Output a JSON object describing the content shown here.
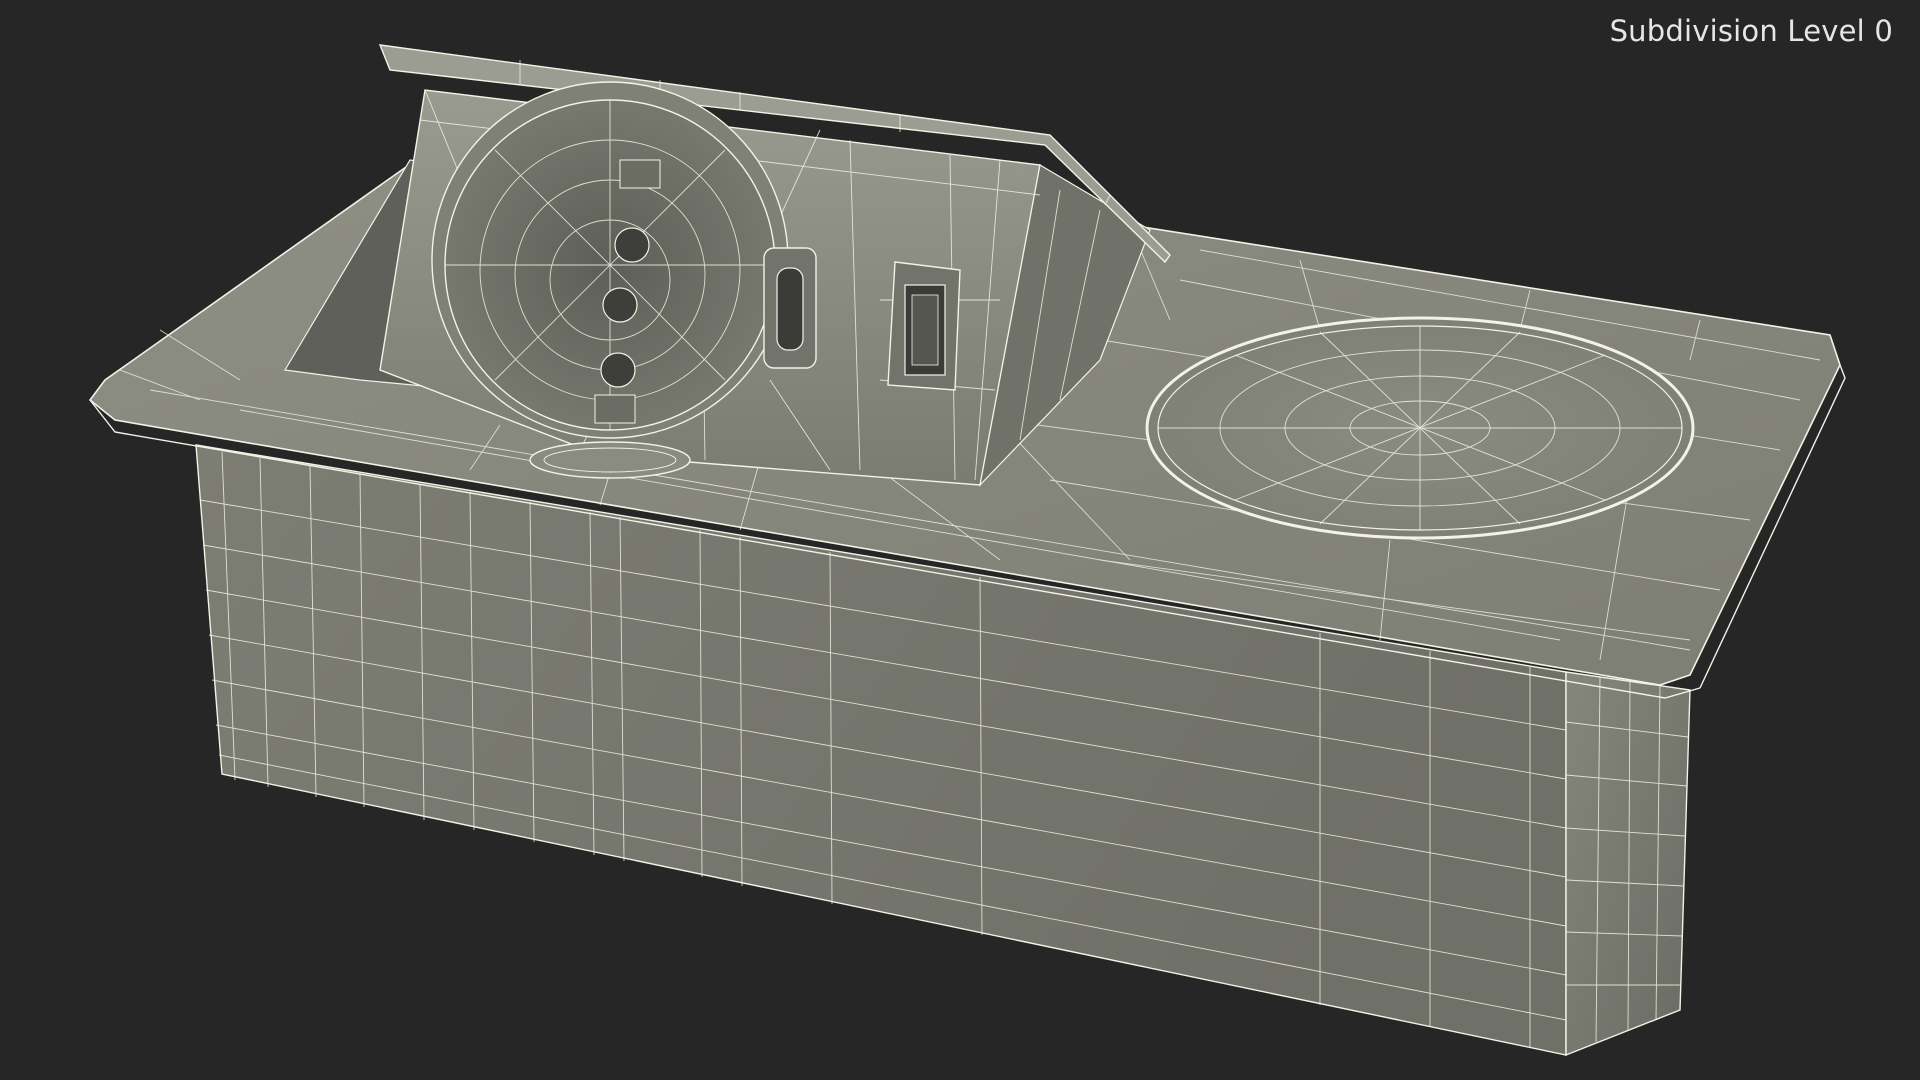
{
  "viewport": {
    "overlay_label": "Subdivision Level 0",
    "background_color": "#262626",
    "wire_color": "#f2f2e6",
    "surface_color": "#7a7b71"
  },
  "model": {
    "icons": [
      "power-socket-icon",
      "usb-c-port-icon",
      "usb-a-port-icon",
      "wireless-charger-pad-icon"
    ]
  }
}
